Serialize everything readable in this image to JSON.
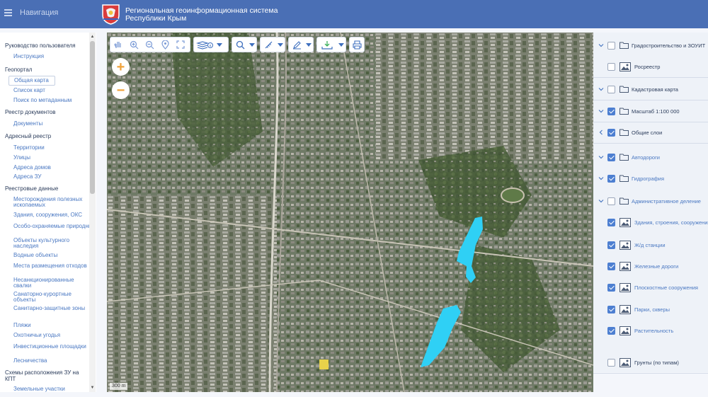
{
  "header": {
    "nav_label": "Навигация",
    "title_line1": "Региональная геоинформационная система",
    "title_line2": "Республики Крым"
  },
  "sidebar": {
    "items": [
      {
        "text": "Руководство пользователя",
        "kind": "section"
      },
      {
        "text": "Инструкция",
        "kind": "item"
      },
      {
        "text": "Геопортал",
        "kind": "section"
      },
      {
        "text": "Общая карта",
        "kind": "item",
        "selected": true
      },
      {
        "text": "Список карт",
        "kind": "item"
      },
      {
        "text": "Поиск по метаданным",
        "kind": "item"
      },
      {
        "text": "Реестр документов",
        "kind": "section"
      },
      {
        "text": "Документы",
        "kind": "item"
      },
      {
        "text": "Адресный реестр",
        "kind": "section"
      },
      {
        "text": "Территории",
        "kind": "item"
      },
      {
        "text": "Улицы",
        "kind": "item"
      },
      {
        "text": "Адреса домов",
        "kind": "item"
      },
      {
        "text": "Адреса ЗУ",
        "kind": "item"
      },
      {
        "text": "Реестровые данные",
        "kind": "section"
      },
      {
        "text": "Месторождения полезных ископаемых",
        "kind": "item"
      },
      {
        "text": "Здания, сооружения, ОКС",
        "kind": "item"
      },
      {
        "text": "Особо-охраняемые природные территории",
        "kind": "item"
      },
      {
        "text": "Объекты культурного наследия",
        "kind": "item"
      },
      {
        "text": "Водные объекты",
        "kind": "item"
      },
      {
        "text": "Места размещения отходов",
        "kind": "item"
      },
      {
        "text": "Несанкционированные свалки",
        "kind": "item"
      },
      {
        "text": "Санаторно-курортные объекты",
        "kind": "item"
      },
      {
        "text": "Санитарно-защитные зоны",
        "kind": "item"
      },
      {
        "text": "Пляжи",
        "kind": "item"
      },
      {
        "text": "Охотничьи угодья",
        "kind": "item"
      },
      {
        "text": "Инвестиционные площадки",
        "kind": "item"
      },
      {
        "text": "Лесничества",
        "kind": "item"
      },
      {
        "text": "Схемы расположения ЗУ на КПТ",
        "kind": "section"
      },
      {
        "text": "Земельные участки",
        "kind": "item"
      }
    ]
  },
  "map": {
    "scale_label": "300 m",
    "water_color": "#2fd0f5",
    "highlight_color": "#e8d24a",
    "toolbar_icons": [
      "hand-pan-icon",
      "zoom-in-icon",
      "zoom-out-icon",
      "location-pin-icon",
      "fullscreen-icon",
      "layers-info-icon",
      "search-icon",
      "measure-icon",
      "draw-pencil-icon",
      "import-icon",
      "print-icon"
    ]
  },
  "layers": [
    {
      "label": "Градостроительство и ЗОУИТ",
      "expander": "down",
      "checked": false,
      "icon": "folder",
      "indent": 0
    },
    {
      "label": "Росреестр",
      "expander": "none",
      "checked": false,
      "icon": "layer",
      "indent": 0
    },
    {
      "label": "Кадастровая карта",
      "expander": "down",
      "checked": false,
      "icon": "folder",
      "indent": 0
    },
    {
      "label": "Масштаб 1:100 000",
      "expander": "down",
      "checked": true,
      "icon": "folder",
      "indent": 0
    },
    {
      "label": "Общие слои",
      "expander": "left",
      "checked": true,
      "icon": "folder",
      "indent": 0
    },
    {
      "label": "Автодороги",
      "expander": "down",
      "checked": true,
      "icon": "folder",
      "indent": 1
    },
    {
      "label": "Гидрография",
      "expander": "down",
      "checked": true,
      "icon": "folder",
      "indent": 1
    },
    {
      "label": "Административное деление",
      "expander": "down",
      "checked": false,
      "icon": "folder",
      "indent": 1
    },
    {
      "label": "Здания, строения, сооружения",
      "expander": "none",
      "checked": true,
      "icon": "layer",
      "indent": 1
    },
    {
      "label": "Ж/д станции",
      "expander": "none",
      "checked": true,
      "icon": "layer",
      "indent": 1
    },
    {
      "label": "Железные дороги",
      "expander": "none",
      "checked": true,
      "icon": "layer",
      "indent": 1
    },
    {
      "label": "Плоскостные сооружения",
      "expander": "none",
      "checked": true,
      "icon": "layer",
      "indent": 1
    },
    {
      "label": "Парки, скверы",
      "expander": "none",
      "checked": true,
      "icon": "layer",
      "indent": 1
    },
    {
      "label": "Растительность",
      "expander": "none",
      "checked": true,
      "icon": "layer",
      "indent": 1
    },
    {
      "label": "Грунты (по типам)",
      "expander": "none",
      "checked": false,
      "icon": "layer",
      "indent": 1
    }
  ]
}
